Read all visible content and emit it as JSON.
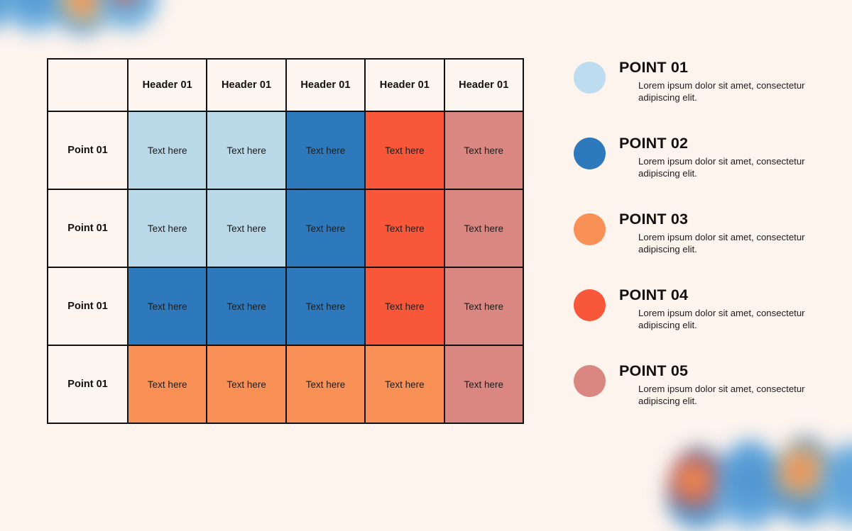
{
  "theme": {
    "background": "#fdf4ee",
    "cell_background": "#fdf5ef",
    "border": "#111111",
    "text": "#111111",
    "light_blue": "#b9d9e8",
    "blue": "#2d79bb",
    "orange": "#f99056",
    "red": "#f8573a",
    "rose": "#d98780"
  },
  "matrix": {
    "corner_label": "",
    "column_headers": [
      "Header 01",
      "Header 01",
      "Header 01",
      "Header 01",
      "Header 01"
    ],
    "rows": [
      {
        "label": "Point 01",
        "cells": [
          {
            "text": "Text here",
            "color": "#b9d9e8"
          },
          {
            "text": "Text here",
            "color": "#b9d9e8"
          },
          {
            "text": "Text here",
            "color": "#2d79bb"
          },
          {
            "text": "Text here",
            "color": "#f8573a"
          },
          {
            "text": "Text here",
            "color": "#d98780"
          }
        ]
      },
      {
        "label": "Point 01",
        "cells": [
          {
            "text": "Text here",
            "color": "#b9d9e8"
          },
          {
            "text": "Text here",
            "color": "#b9d9e8"
          },
          {
            "text": "Text here",
            "color": "#2d79bb"
          },
          {
            "text": "Text here",
            "color": "#f8573a"
          },
          {
            "text": "Text here",
            "color": "#d98780"
          }
        ]
      },
      {
        "label": "Point 01",
        "cells": [
          {
            "text": "Text here",
            "color": "#2d79bb"
          },
          {
            "text": "Text here",
            "color": "#2d79bb"
          },
          {
            "text": "Text here",
            "color": "#2d79bb"
          },
          {
            "text": "Text here",
            "color": "#f8573a"
          },
          {
            "text": "Text here",
            "color": "#d98780"
          }
        ]
      },
      {
        "label": "Point 01",
        "cells": [
          {
            "text": "Text here",
            "color": "#f99056"
          },
          {
            "text": "Text here",
            "color": "#f99056"
          },
          {
            "text": "Text here",
            "color": "#f99056"
          },
          {
            "text": "Text here",
            "color": "#f99056"
          },
          {
            "text": "Text here",
            "color": "#d98780"
          }
        ]
      }
    ]
  },
  "legend": {
    "items": [
      {
        "title": "POINT 01",
        "description": "Lorem ipsum dolor sit amet, consectetur adipiscing elit.",
        "color": "#bddcef"
      },
      {
        "title": "POINT 02",
        "description": "Lorem ipsum dolor sit amet, consectetur adipiscing elit.",
        "color": "#2d79bb"
      },
      {
        "title": "POINT 03",
        "description": "Lorem ipsum dolor sit amet, consectetur adipiscing elit.",
        "color": "#f99056"
      },
      {
        "title": "POINT 04",
        "description": "Lorem ipsum dolor sit amet, consectetur adipiscing elit.",
        "color": "#f8573a"
      },
      {
        "title": "POINT 05",
        "description": "Lorem ipsum dolor sit amet, consectetur adipiscing elit.",
        "color": "#d98780"
      }
    ]
  },
  "decorations": [
    {
      "name": "top-left-blob"
    },
    {
      "name": "bottom-right-blob"
    }
  ]
}
